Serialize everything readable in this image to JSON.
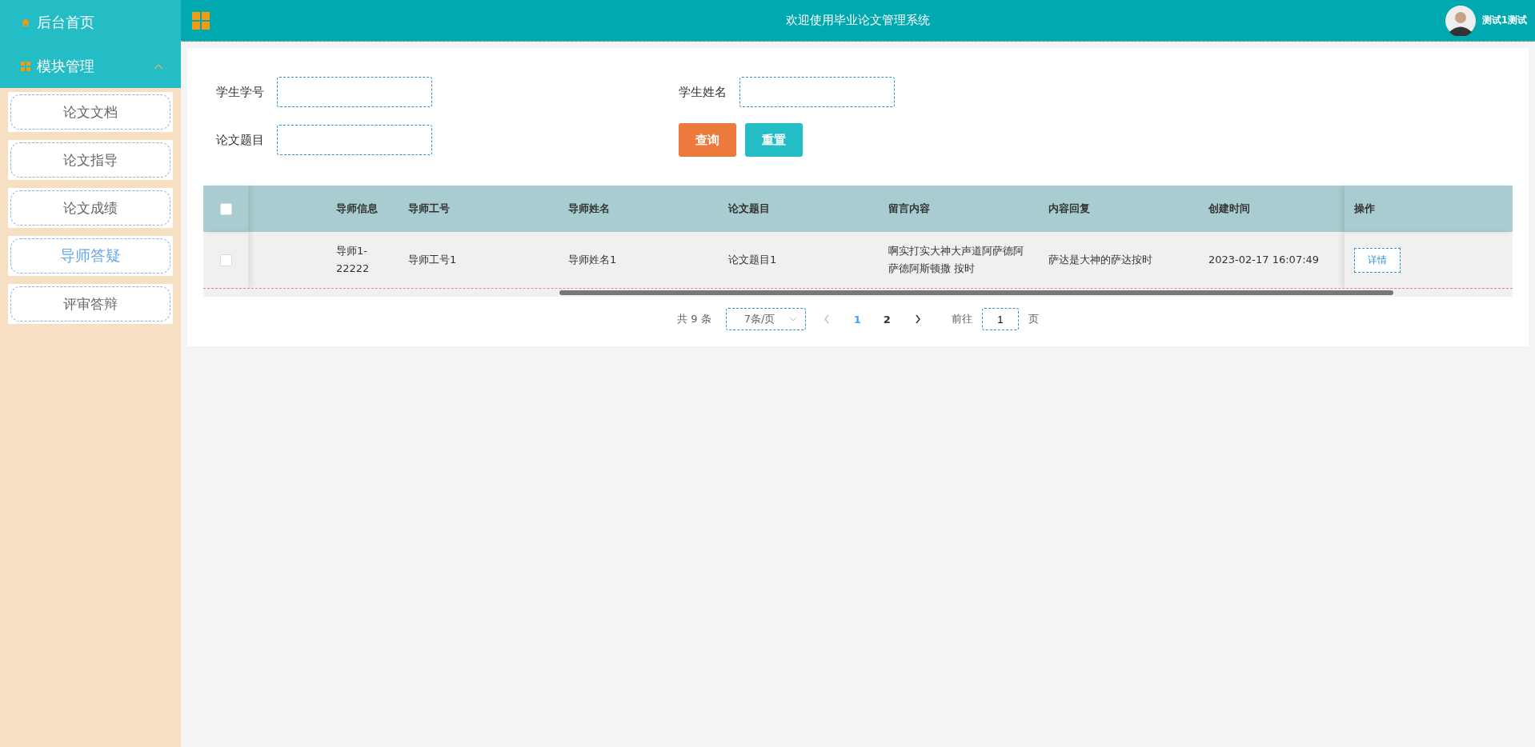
{
  "sidebar": {
    "items": [
      {
        "label": "后台首页",
        "kind": "home"
      },
      {
        "label": "模块管理",
        "kind": "group",
        "expanded": true,
        "children": [
          {
            "label": "论文文档",
            "selected": false
          },
          {
            "label": "论文指导",
            "selected": false
          },
          {
            "label": "论文成绩",
            "selected": false
          },
          {
            "label": "导师答疑",
            "selected": true
          },
          {
            "label": "评审答辩",
            "selected": false
          }
        ]
      }
    ]
  },
  "header": {
    "title": "欢迎使用毕业论文管理系统",
    "user": "测试1测试"
  },
  "search_form": {
    "fields": [
      {
        "label": "学生学号"
      },
      {
        "label": "学生姓名"
      },
      {
        "label": "论文题目"
      }
    ],
    "buttons": [
      {
        "label": "查询",
        "kind": "primary"
      },
      {
        "label": "重置",
        "kind": "secondary"
      }
    ]
  },
  "table": {
    "select_all": false,
    "columns": [
      "导师信息",
      "导师工号",
      "导师姓名",
      "论文题目",
      "留言内容",
      "内容回复",
      "创建时间",
      "操作"
    ],
    "rows": [
      {
        "checked": false,
        "cells": [
          "导师1-22222",
          "导师工号1",
          "导师姓名1",
          "论文题目1",
          "啊实打实大神大声道阿萨德阿萨德阿斯顿撒 按时",
          "萨达是大神的萨达按时",
          "2023-02-17 16:07:49"
        ],
        "action": "详情"
      }
    ]
  },
  "pagination": {
    "total": "共 9 条",
    "page_size": "7条/页",
    "pages": [
      {
        "label": "1",
        "selected": true
      },
      {
        "label": "2",
        "selected": false
      }
    ],
    "goto_label": "前往",
    "goto_value": "1",
    "goto_suffix": "页"
  }
}
